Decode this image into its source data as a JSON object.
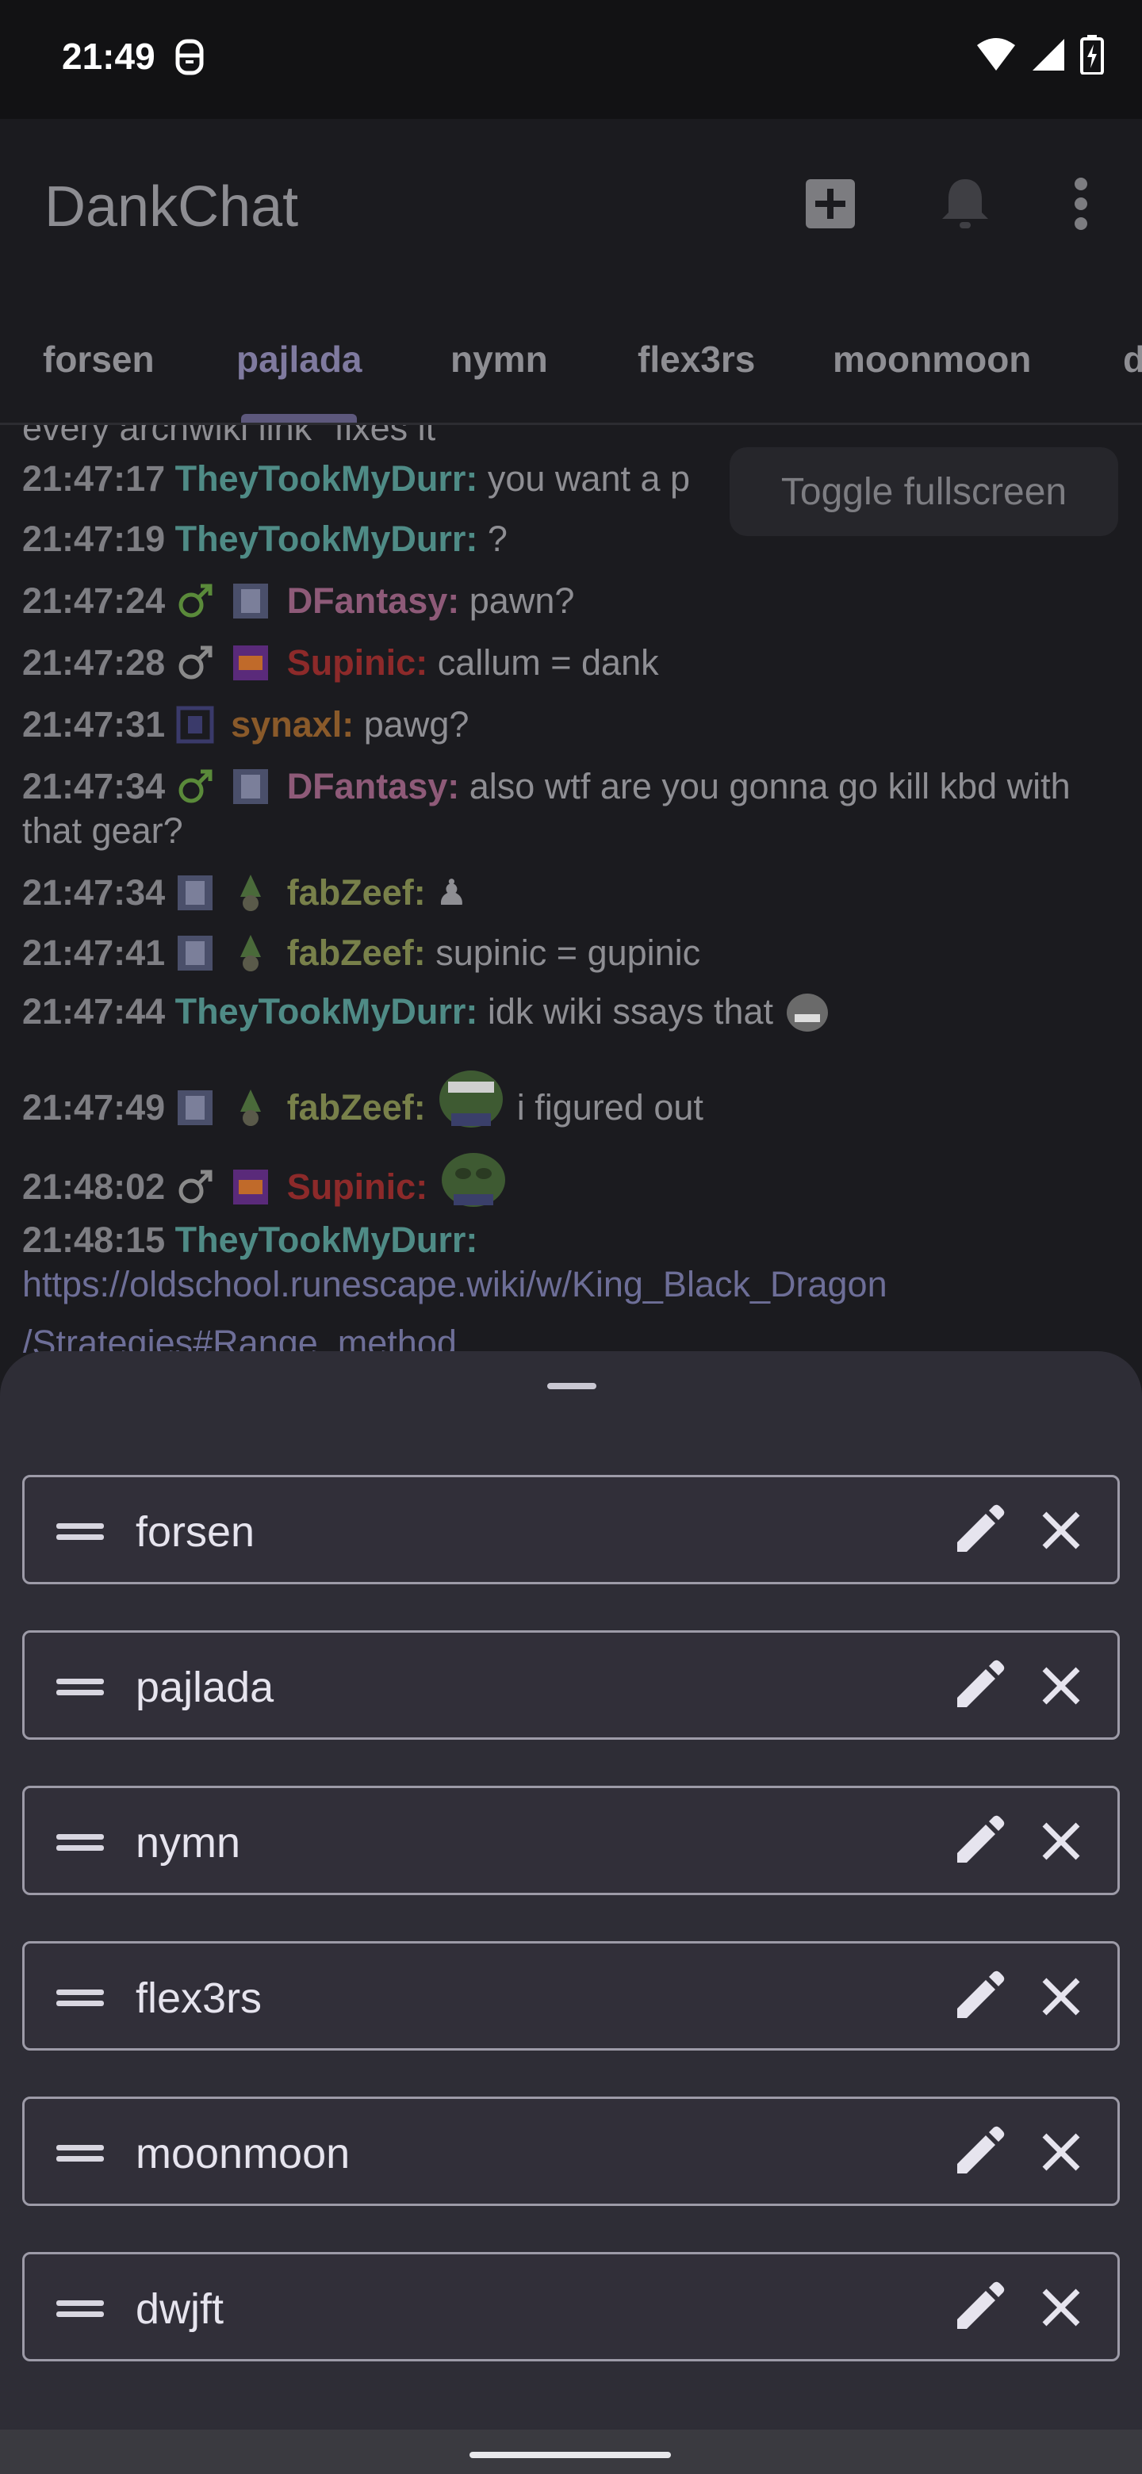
{
  "status_bar": {
    "time": "21:49"
  },
  "app_bar": {
    "title": "DankChat",
    "icons": [
      "add-channel-icon",
      "bell-icon",
      "more-options-icon"
    ]
  },
  "tabs": [
    {
      "label": "forsen"
    },
    {
      "label": "pajlada",
      "active": true
    },
    {
      "label": "nymn"
    },
    {
      "label": "flex3rs"
    },
    {
      "label": "moonmoon"
    },
    {
      "label": "d"
    }
  ],
  "tooltip": "Toggle fullscreen",
  "chat": {
    "partial_top": "every archwiki link \"fixes it\"",
    "messages": [
      {
        "time": "21:47:17",
        "user": "TheyTookMyDurr:",
        "color": "#4f8b86",
        "text": "you want a p"
      },
      {
        "time": "21:47:19",
        "user": "TheyTookMyDurr:",
        "color": "#4f8b86",
        "text": "?"
      },
      {
        "time": "21:47:24",
        "user": "DFantasy:",
        "color": "#8e5a78",
        "text": "pawn?"
      },
      {
        "time": "21:47:28",
        "user": "Supinic:",
        "color": "#8d2a2a",
        "text": "callum = dank"
      },
      {
        "time": "21:47:31",
        "user": "synaxl:",
        "color": "#8a5a2a",
        "text": "pawg?"
      },
      {
        "time": "21:47:34",
        "user": "DFantasy:",
        "color": "#8e5a78",
        "text": "also wtf are you gonna go kill kbd with that gear?"
      },
      {
        "time": "21:47:34",
        "user": "fabZeef:",
        "color": "#78804a",
        "text": "♟"
      },
      {
        "time": "21:47:41",
        "user": "fabZeef:",
        "color": "#78804a",
        "text": "supinic = gupinic"
      },
      {
        "time": "21:47:44",
        "user": "TheyTookMyDurr:",
        "color": "#4f8b86",
        "text": "idk wiki ssays that"
      },
      {
        "time": "21:47:49",
        "user": "fabZeef:",
        "color": "#78804a",
        "text": "i figured out"
      },
      {
        "time": "21:48:02",
        "user": "Supinic:",
        "color": "#8d2a2a",
        "text": ""
      },
      {
        "time": "21:48:15",
        "user": "TheyTookMyDurr:",
        "color": "#4f8b86",
        "text": "https://oldschool.runescape.wiki/w/King_Black_Dragon"
      }
    ],
    "partial_bottom": "/Strategies#Range_method"
  },
  "channels": [
    {
      "name": "forsen"
    },
    {
      "name": "pajlada"
    },
    {
      "name": "nymn"
    },
    {
      "name": "flex3rs"
    },
    {
      "name": "moonmoon"
    },
    {
      "name": "dwjft"
    }
  ]
}
